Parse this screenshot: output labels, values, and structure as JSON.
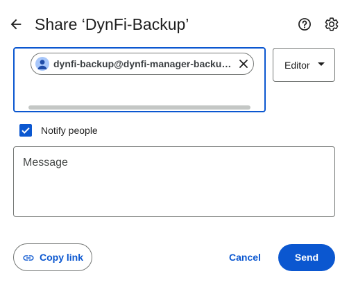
{
  "header": {
    "title": "Share ‘DynFi-Backup’",
    "back_icon": "arrow-back-icon",
    "help_icon": "help-circle-icon",
    "settings_icon": "gear-icon"
  },
  "recipients": {
    "chips": [
      {
        "label": "dynfi-backup@dynfi-manager-backup.iam.gserviceaccount.com",
        "avatar_icon": "person-avatar-icon",
        "remove_icon": "close-icon"
      }
    ]
  },
  "role": {
    "selected": "Editor"
  },
  "notify": {
    "label": "Notify people",
    "checked": true
  },
  "message": {
    "placeholder": "Message",
    "value": ""
  },
  "footer": {
    "copy_link_label": "Copy link",
    "cancel_label": "Cancel",
    "send_label": "Send"
  },
  "colors": {
    "accent": "#0b57d0",
    "outline": "#747775",
    "text": "#1f1f1f"
  }
}
